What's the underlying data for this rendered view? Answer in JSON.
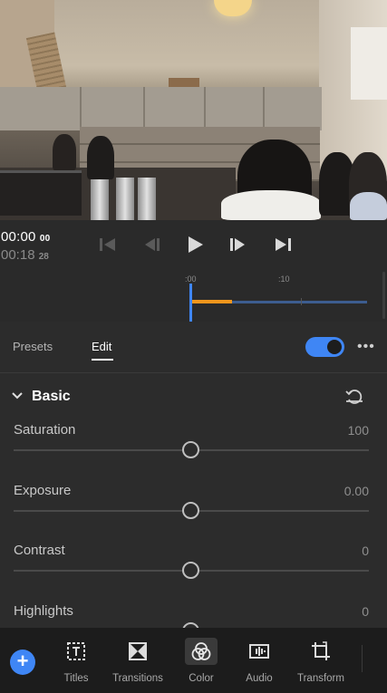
{
  "transport": {
    "current_time": "00:00",
    "current_frames": "00",
    "total_time": "00:18",
    "total_frames": "28"
  },
  "timeline": {
    "ruler_labels": [
      ":00",
      ":10"
    ]
  },
  "tabs": {
    "presets": "Presets",
    "edit": "Edit",
    "enabled": true
  },
  "section": {
    "title": "Basic"
  },
  "params": [
    {
      "label": "Saturation",
      "value": "100",
      "level": 0.5
    },
    {
      "label": "Exposure",
      "value": "0.00",
      "level": 0.5
    },
    {
      "label": "Contrast",
      "value": "0",
      "level": 0.5
    },
    {
      "label": "Highlights",
      "value": "0",
      "level": 0.5
    }
  ],
  "toolbar": {
    "add_icon": "plus-icon",
    "items": [
      {
        "label": "Titles",
        "icon": "titles-icon"
      },
      {
        "label": "Transitions",
        "icon": "transitions-icon"
      },
      {
        "label": "Color",
        "icon": "color-icon",
        "selected": true
      },
      {
        "label": "Audio",
        "icon": "audio-icon"
      },
      {
        "label": "Transform",
        "icon": "transform-icon"
      }
    ]
  },
  "colors": {
    "accent": "#3f86f5",
    "clip_in": "#f0961c",
    "panel": "#2c2c2c"
  }
}
